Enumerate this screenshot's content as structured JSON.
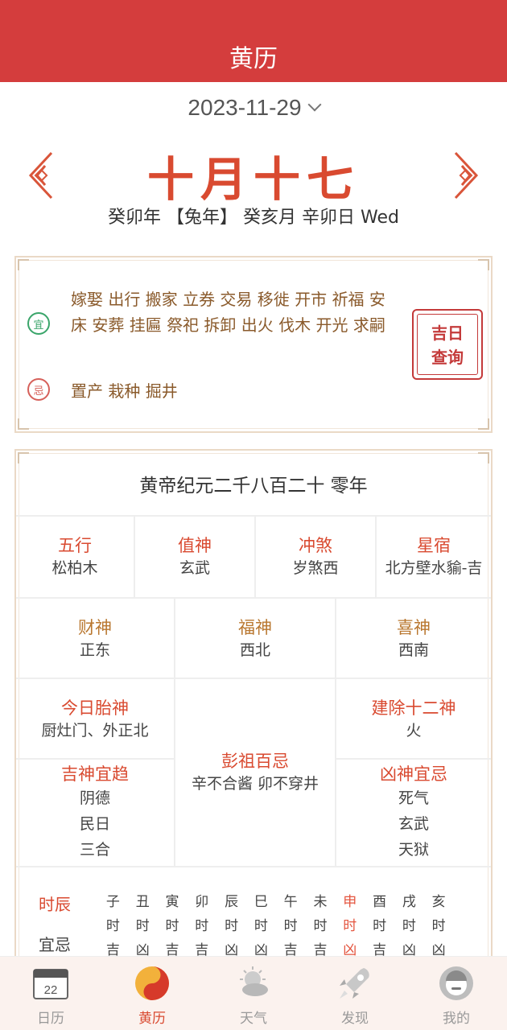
{
  "header": {
    "title": "黄历"
  },
  "date": {
    "label": "2023-11-29"
  },
  "lunar": {
    "day": "十月十七",
    "ganzhi": "癸卯年 【兔年】 癸亥月 辛卯日 Wed"
  },
  "yiji": {
    "yi_badge": "宜",
    "ji_badge": "忌",
    "yi_text": "嫁娶 出行 搬家 立券 交易 移徙 开市 祈福 安床 安葬 挂匾 祭祀 拆卸 出火 伐木 开光 求嗣",
    "ji_text": "置产 栽种 掘井",
    "query_line1": "吉日",
    "query_line2": "查询"
  },
  "detail": {
    "era": "黄帝纪元二千八百二十 零年",
    "row1": [
      {
        "k": "五行",
        "v": "松柏木"
      },
      {
        "k": "值神",
        "v": "玄武"
      },
      {
        "k": "冲煞",
        "v": "岁煞西"
      },
      {
        "k": "星宿",
        "v": "北方壁水貐-吉"
      }
    ],
    "row2": [
      {
        "k": "财神",
        "v": "正东"
      },
      {
        "k": "福神",
        "v": "西北"
      },
      {
        "k": "喜神",
        "v": "西南"
      }
    ],
    "taishen": {
      "k": "今日胎神",
      "v": "厨灶门、外正北"
    },
    "jianchu": {
      "k": "建除十二神",
      "v": "火"
    },
    "pengzu": {
      "k": "彭祖百忌",
      "v": "辛不合酱 卯不穿井"
    },
    "jishen": {
      "k": "吉神宜趋",
      "items": [
        "阴德",
        "民日",
        "三合"
      ]
    },
    "xiongshen": {
      "k": "凶神宜忌",
      "items": [
        "死气",
        "玄武",
        "天狱"
      ]
    },
    "shichen_label": "时辰",
    "yiji_label": "宜忌",
    "hours": [
      {
        "z": "子",
        "s": "时",
        "r": "吉"
      },
      {
        "z": "丑",
        "s": "时",
        "r": "凶"
      },
      {
        "z": "寅",
        "s": "时",
        "r": "吉"
      },
      {
        "z": "卯",
        "s": "时",
        "r": "吉"
      },
      {
        "z": "辰",
        "s": "时",
        "r": "凶"
      },
      {
        "z": "巳",
        "s": "时",
        "r": "凶"
      },
      {
        "z": "午",
        "s": "时",
        "r": "吉"
      },
      {
        "z": "未",
        "s": "时",
        "r": "吉"
      },
      {
        "z": "申",
        "s": "时",
        "r": "凶"
      },
      {
        "z": "酉",
        "s": "时",
        "r": "吉"
      },
      {
        "z": "戌",
        "s": "时",
        "r": "凶"
      },
      {
        "z": "亥",
        "s": "时",
        "r": "凶"
      }
    ]
  },
  "tabs": {
    "calendar_day": "22",
    "items": [
      "日历",
      "黄历",
      "天气",
      "发现",
      "我的"
    ]
  },
  "colors": {
    "brand": "#d43d3d",
    "accent": "#d94a30",
    "gold": "#b9772f",
    "yi": "#3aa56a",
    "ji": "#d6605a"
  }
}
